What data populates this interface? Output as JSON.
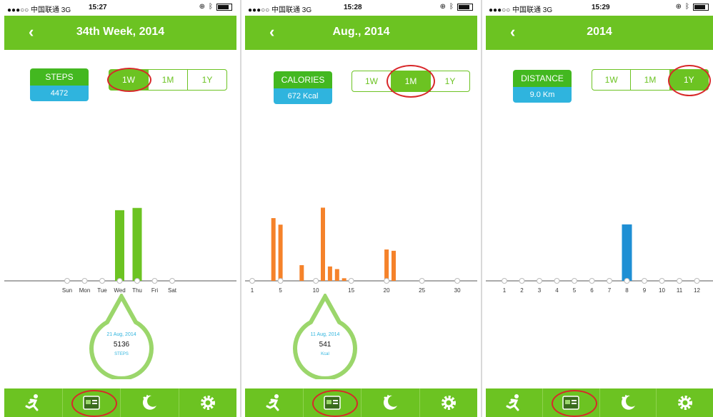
{
  "status_bar": {
    "carrier": "●●●○○ 中国联通 3G",
    "times": [
      "15:27",
      "15:28",
      "15:29"
    ]
  },
  "screens": [
    {
      "title": "34th Week, 2014",
      "metric": {
        "label": "STEPS",
        "value": "4472"
      },
      "segments": [
        "1W",
        "1M",
        "1Y"
      ],
      "selected": "1W",
      "tooltip": {
        "date": "21 Aug, 2014",
        "value": "5136",
        "note": "STEPS"
      },
      "chart_data": {
        "type": "bar",
        "categories": [
          "Sun",
          "Mon",
          "Tue",
          "Wed",
          "Thu",
          "Fri",
          "Sat"
        ],
        "values": [
          0,
          0,
          0,
          5136,
          5300,
          0,
          0
        ],
        "color": "#6cc322"
      }
    },
    {
      "title": "Aug., 2014",
      "metric": {
        "label": "CALORIES",
        "value": "672 Kcal"
      },
      "segments": [
        "1W",
        "1M",
        "1Y"
      ],
      "selected": "1M",
      "tooltip": {
        "date": "11 Aug, 2014",
        "value": "541",
        "note": "Kcal"
      },
      "chart_data": {
        "type": "bar",
        "x": [
          1,
          2,
          3,
          4,
          5,
          6,
          7,
          8,
          9,
          10,
          11,
          12,
          13,
          14,
          15,
          16,
          17,
          18,
          19,
          20,
          21,
          22,
          23,
          24,
          25,
          26,
          27,
          28,
          29,
          30,
          31
        ],
        "x_tick_labels": [
          "1",
          "5",
          "10",
          "15",
          "20",
          "25",
          "30"
        ],
        "values": [
          0,
          0,
          0,
          480,
          430,
          0,
          0,
          120,
          0,
          0,
          560,
          110,
          90,
          20,
          0,
          0,
          0,
          0,
          0,
          240,
          230,
          0,
          0,
          0,
          0,
          0,
          0,
          0,
          0,
          0,
          0
        ],
        "color": "#f5822a"
      }
    },
    {
      "title": "2014",
      "metric": {
        "label": "DISTANCE",
        "value": "9.0 Km"
      },
      "segments": [
        "1W",
        "1M",
        "1Y"
      ],
      "selected": "1Y",
      "chart_data": {
        "type": "bar",
        "categories": [
          "1",
          "2",
          "3",
          "4",
          "5",
          "6",
          "7",
          "8",
          "9",
          "10",
          "11",
          "12"
        ],
        "values": [
          0,
          0,
          0,
          0,
          0,
          0,
          0,
          9.0,
          0,
          0,
          0,
          0
        ],
        "color": "#1e8fd4"
      }
    }
  ],
  "nav_icons": [
    "runner-icon",
    "calendar-icon",
    "moon-icon",
    "gear-icon"
  ],
  "colors": {
    "header": "#6cc322",
    "highlight_ring": "#d8282a",
    "metric_value_bg": "#2fb4de"
  }
}
